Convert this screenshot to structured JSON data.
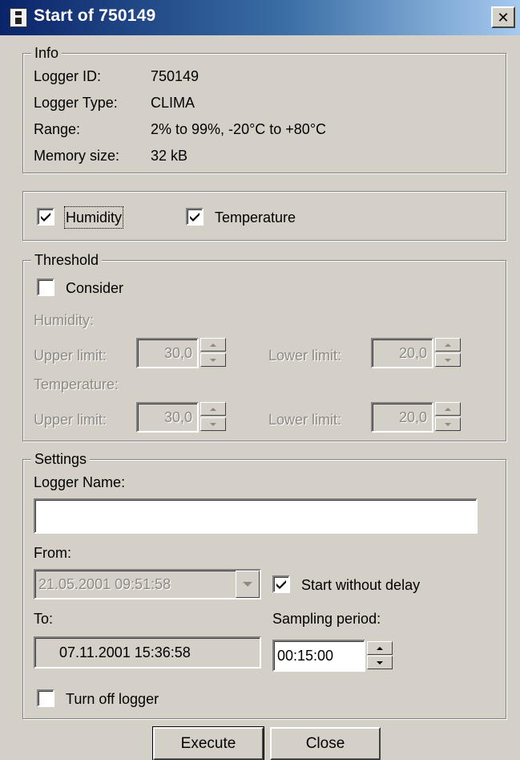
{
  "window": {
    "title": "Start of 750149",
    "close_glyph": "✕"
  },
  "info": {
    "legend": "Info",
    "rows": [
      {
        "label": "Logger ID:",
        "value": "750149"
      },
      {
        "label": "Logger Type:",
        "value": "CLIMA"
      },
      {
        "label": "Range:",
        "value": "2% to 99%, -20°C to +80°C"
      },
      {
        "label": "Memory size:",
        "value": "32 kB"
      }
    ]
  },
  "channels": {
    "humidity": {
      "label": "Humidity",
      "checked": true
    },
    "temperature": {
      "label": "Temperature",
      "checked": true
    }
  },
  "threshold": {
    "legend": "Threshold",
    "consider_label": "Consider",
    "consider_checked": false,
    "humidity_heading": "Humidity:",
    "temperature_heading": "Temperature:",
    "upper_label": "Upper limit:",
    "lower_label": "Lower limit:",
    "humidity_upper": "30,0",
    "humidity_lower": "20,0",
    "temperature_upper": "30,0",
    "temperature_lower": "20,0"
  },
  "settings": {
    "legend": "Settings",
    "logger_name_label": "Logger Name:",
    "logger_name_value": "",
    "from_label": "From:",
    "from_value": "21.05.2001 09:51:58",
    "start_without_delay_label": "Start without delay",
    "start_without_delay_checked": true,
    "to_label": "To:",
    "to_value": "07.11.2001 15:36:58",
    "sampling_period_label": "Sampling period:",
    "sampling_period_value": "00:15:00",
    "turn_off_label": "Turn off logger",
    "turn_off_checked": false
  },
  "buttons": {
    "execute": "Execute",
    "close": "Close"
  },
  "colors": {
    "face": "#d4d0c8",
    "title_dark": "#0a246a",
    "title_light": "#a6caf0",
    "disabled_text": "#8d8a83"
  }
}
